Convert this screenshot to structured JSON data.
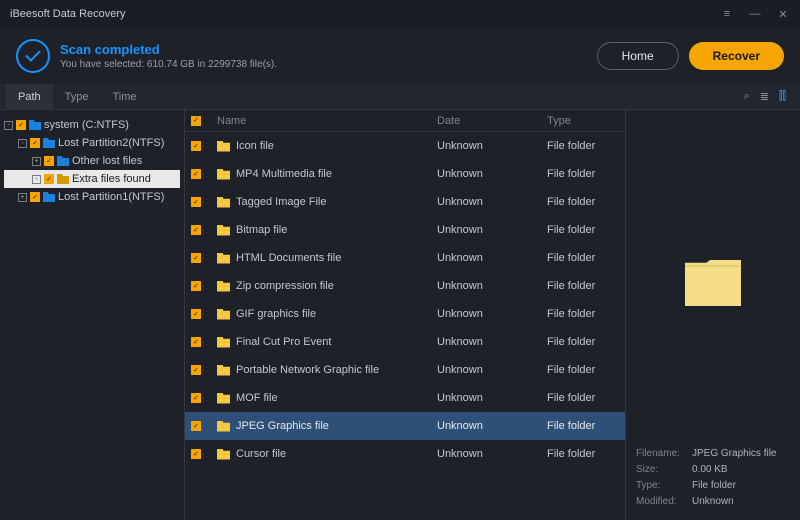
{
  "window": {
    "title": "iBeesoft Data Recovery"
  },
  "scan": {
    "status": "Scan completed",
    "detail": "You have selected: 610.74 GB in 2299738 file(s)."
  },
  "buttons": {
    "home": "Home",
    "recover": "Recover"
  },
  "tabs": [
    "Path",
    "Type",
    "Time"
  ],
  "active_tab": 0,
  "tree": [
    {
      "level": 0,
      "exp": "-",
      "label": "system (C:NTFS)",
      "selected": false
    },
    {
      "level": 1,
      "exp": "-",
      "label": "Lost Partition2(NTFS)",
      "selected": false
    },
    {
      "level": 2,
      "exp": "+",
      "label": "Other lost files",
      "selected": false
    },
    {
      "level": 2,
      "exp": "+",
      "label": "Extra files found",
      "selected": true
    },
    {
      "level": 1,
      "exp": "+",
      "label": "Lost Partition1(NTFS)",
      "selected": false
    }
  ],
  "columns": {
    "name": "Name",
    "date": "Date",
    "type": "Type"
  },
  "rows": [
    {
      "name": "Icon file",
      "date": "Unknown",
      "type": "File folder"
    },
    {
      "name": "MP4 Multimedia file",
      "date": "Unknown",
      "type": "File folder"
    },
    {
      "name": "Tagged Image File",
      "date": "Unknown",
      "type": "File folder"
    },
    {
      "name": "Bitmap file",
      "date": "Unknown",
      "type": "File folder"
    },
    {
      "name": "HTML Documents file",
      "date": "Unknown",
      "type": "File folder"
    },
    {
      "name": "Zip compression file",
      "date": "Unknown",
      "type": "File folder"
    },
    {
      "name": "GIF graphics file",
      "date": "Unknown",
      "type": "File folder"
    },
    {
      "name": "Final Cut Pro Event",
      "date": "Unknown",
      "type": "File folder"
    },
    {
      "name": "Portable Network Graphic file",
      "date": "Unknown",
      "type": "File folder"
    },
    {
      "name": "MOF file",
      "date": "Unknown",
      "type": "File folder"
    },
    {
      "name": "JPEG Graphics file",
      "date": "Unknown",
      "type": "File folder"
    },
    {
      "name": "Cursor file",
      "date": "Unknown",
      "type": "File folder"
    }
  ],
  "selected_row": 10,
  "preview": {
    "filename_k": "Filename:",
    "filename_v": "JPEG Graphics file",
    "size_k": "Size:",
    "size_v": "0.00 KB",
    "type_k": "Type:",
    "type_v": "File folder",
    "modified_k": "Modified:",
    "modified_v": "Unknown"
  }
}
